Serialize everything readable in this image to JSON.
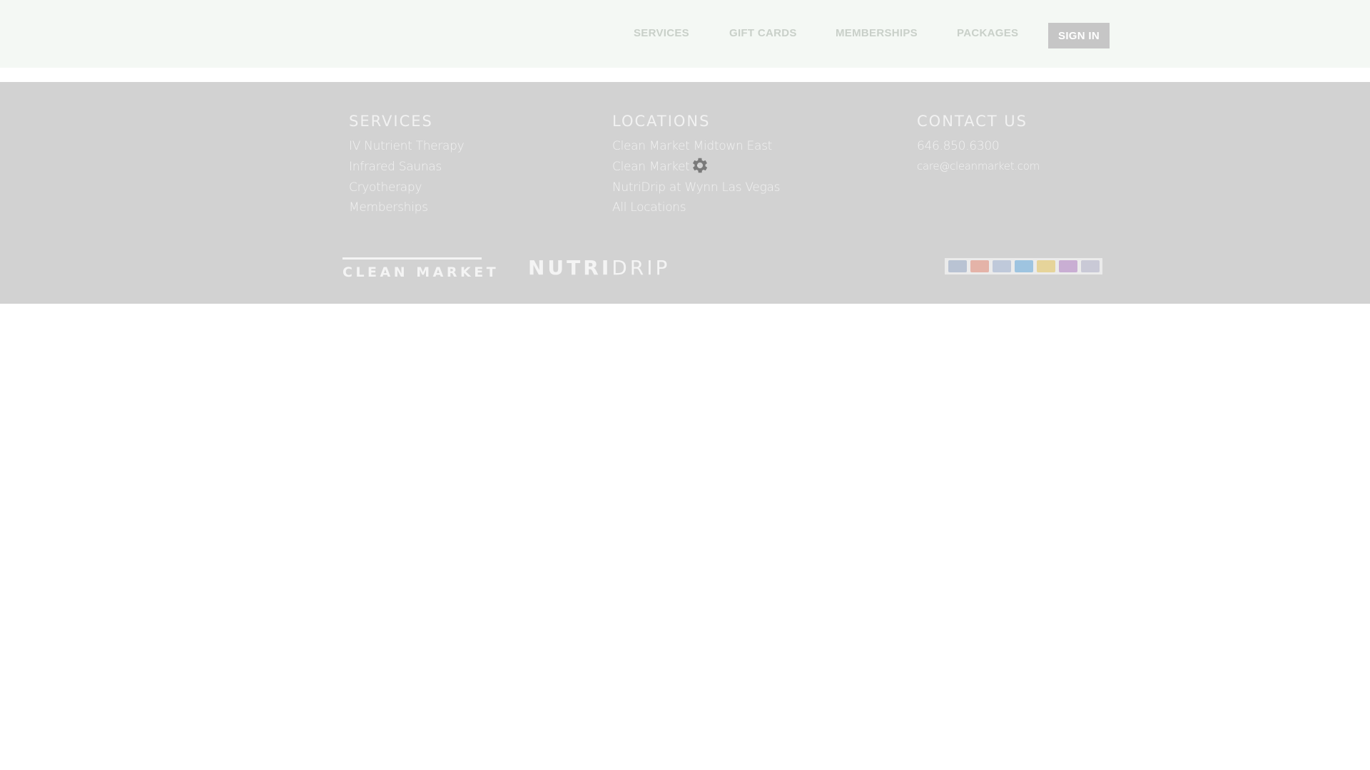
{
  "nav": {
    "items": [
      {
        "id": "services",
        "label": "SERVICES"
      },
      {
        "id": "gift-cards",
        "label": "GIFT CARDS"
      },
      {
        "id": "memberships",
        "label": "MEMBERSHIPS"
      },
      {
        "id": "packages",
        "label": "PACKAGES"
      }
    ],
    "signin_label": "SIGN IN"
  },
  "footer": {
    "services": {
      "title": "SERVICES",
      "links": [
        "IV Nutrient Therapy",
        "Infrared Saunas",
        "Cryotherapy",
        "Memberships"
      ]
    },
    "locations": {
      "title": "LOCATIONS",
      "links": [
        "Clean Market Midtown East",
        "Clean Market F",
        "NutriDrip at Wynn Las Vegas",
        "All Locations"
      ]
    },
    "contact": {
      "title": "CONTACT US",
      "phone": "646.850.6300",
      "email": "care@cleanmarket.com"
    },
    "logos": {
      "clean_market": "CLEAN MARKET",
      "nutridrip_bold": "NUTRI",
      "nutridrip_light": "DRIP"
    },
    "payment_icons": [
      {
        "name": "visa-card-icon",
        "color": "#b9c3d3"
      },
      {
        "name": "mastercard-card-icon",
        "color": "#e4b3a8"
      },
      {
        "name": "paypal-card-icon",
        "color": "#bfc9da"
      },
      {
        "name": "amex-card-icon",
        "color": "#9ec4e0"
      },
      {
        "name": "mastercard-alt-card-icon",
        "color": "#e6d49a"
      },
      {
        "name": "discover-card-icon",
        "color": "#c9aed3"
      },
      {
        "name": "generic-card-icon",
        "color": "#c9c9d6"
      }
    ]
  },
  "colors": {
    "header_bg": "#f4f8f4",
    "footer_bg": "#d2d2d2",
    "signin_bg": "#c6c6c6"
  }
}
